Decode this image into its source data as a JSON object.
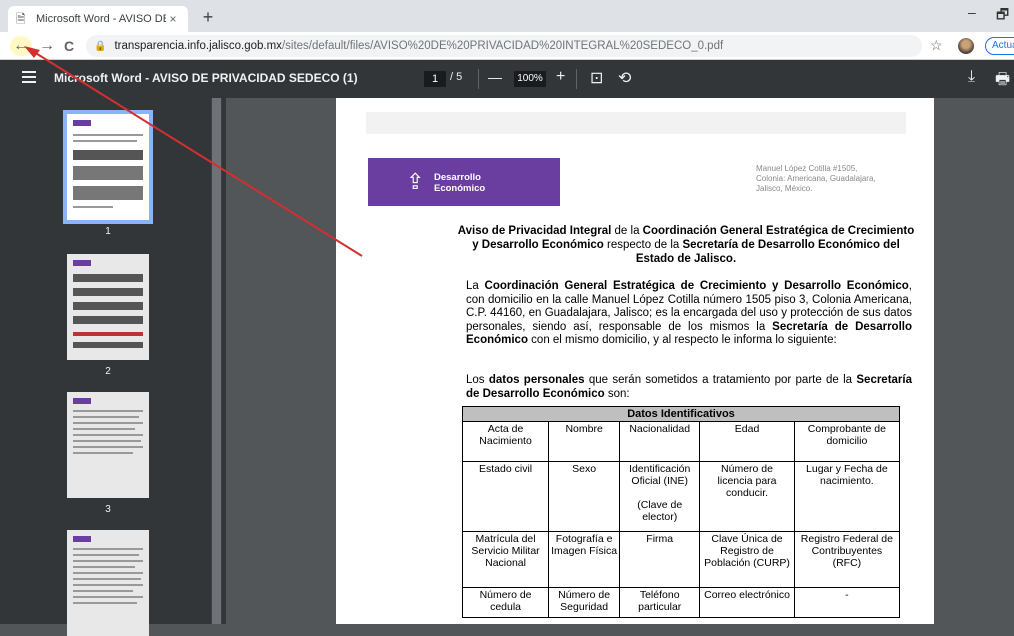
{
  "browser": {
    "tab_title": "Microsoft Word - AVISO DE PRIV",
    "tab_close": "×",
    "new_tab": "+",
    "url_host": "transparencia.info.jalisco.gob.mx",
    "url_path": "/sites/default/files/AVISO%20DE%20PRIVACIDAD%20INTEGRAL%20SEDECO_0.pdf",
    "update_label": "Actua",
    "back": "←",
    "forward": "→",
    "reload": "C",
    "star": "☆",
    "minimize": "–",
    "restore": "🗗"
  },
  "pdf_toolbar": {
    "title": "Microsoft Word - AVISO DE PRIVACIDAD SEDECO (1)",
    "page_current": "1",
    "page_total": "/ 5",
    "zoom_out": "—",
    "zoom_value": "100%",
    "zoom_in": "+",
    "fit_icon": "⊡",
    "rotate_icon": "⟲",
    "download_icon": "⤓",
    "print_icon": "🖶"
  },
  "thumbnails": [
    {
      "number": "1",
      "selected": true
    },
    {
      "number": "2",
      "selected": false
    },
    {
      "number": "3",
      "selected": false
    },
    {
      "number": "",
      "selected": false
    }
  ],
  "document": {
    "logo_line1": "Desarrollo",
    "logo_line2": "Económico",
    "address_line1": "Manuel López Cotilla #1505,",
    "address_line2": "Colonia: Americana, Guadalajara,",
    "address_line3": "Jalisco, México.",
    "heading_b1": "Aviso de Privacidad Integral",
    "heading_t1": " de la ",
    "heading_b2": "Coordinación General Estratégica de Crecimiento y Desarrollo Económico",
    "heading_t2": " respecto de la ",
    "heading_b3": "Secretaría de Desarrollo Económico del Estado de Jalisco.",
    "p1_t1": "La ",
    "p1_b1": "Coordinación General Estratégica de Crecimiento y Desarrollo Económico",
    "p1_t2": ", con domicilio en la calle Manuel López Cotilla número 1505 piso 3, Colonia Americana, C.P. 44160, en Guadalajara, Jalisco; es la encargada del uso y protección de sus datos personales, siendo así, responsable de los mismos la ",
    "p1_b2": "Secretaría de Desarrollo Económico",
    "p1_t3": " con el mismo domicilio, y al respecto le informa lo siguiente:",
    "p2_t1": "Los ",
    "p2_b1": "datos personales",
    "p2_t2": " que serán sometidos a tratamiento por parte de la ",
    "p2_b2": "Secretaría de Desarrollo Económico",
    "p2_t3": " son:",
    "table_header": "Datos Identificativos",
    "table_rows": [
      [
        "Acta de Nacimiento",
        "Nombre",
        "Nacionalidad",
        "Edad",
        "Comprobante de domicilio"
      ],
      [
        "Estado civil",
        "Sexo",
        "Identificación Oficial (INE)\n\n(Clave de elector)",
        "Número de licencia para conducir.",
        "Lugar y Fecha de nacimiento."
      ],
      [
        "Matrícula del Servicio Militar Nacional",
        "Fotografía e Imagen Física",
        "Firma",
        "Clave Única de Registro de Población (CURP)",
        "Registro Federal de Contribuyentes (RFC)"
      ],
      [
        "Número de cedula",
        "Número de Seguridad",
        "Teléfono particular",
        "Correo electrónico",
        "-"
      ]
    ]
  },
  "colors": {
    "logo_purple": "#6a3ea1",
    "annotation_red": "#d32f2f",
    "pdf_toolbar": "#323639"
  }
}
